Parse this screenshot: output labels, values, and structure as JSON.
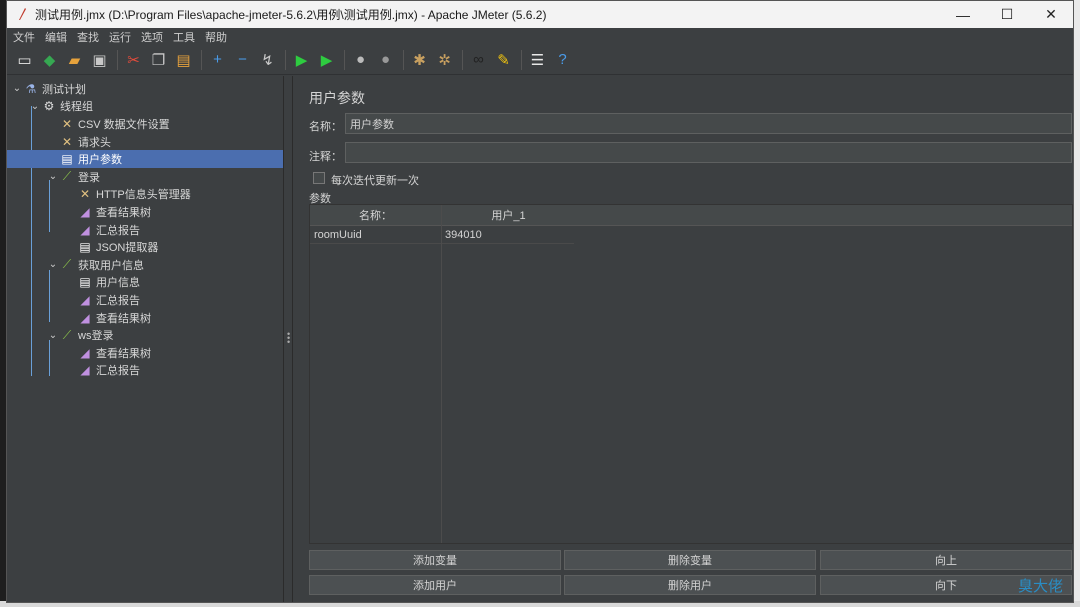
{
  "window": {
    "title": "测试用例.jmx (D:\\Program Files\\apache-jmeter-5.6.2\\用例\\测试用例.jmx) - Apache JMeter (5.6.2)",
    "minimize": "—",
    "maximize": "☐",
    "close": "✕"
  },
  "menu": [
    "文件",
    "编辑",
    "查找",
    "运行",
    "选项",
    "工具",
    "帮助"
  ],
  "toolbar": [
    {
      "icon": "new-icon",
      "glyph": "▭",
      "color": "#e8e8e8"
    },
    {
      "icon": "templates-icon",
      "glyph": "◆",
      "color": "#36a852"
    },
    {
      "icon": "open-icon",
      "glyph": "▰",
      "color": "#e6a23c"
    },
    {
      "icon": "save-icon",
      "glyph": "▣",
      "color": "#c8c8c8"
    },
    {
      "icon": "cut-icon",
      "glyph": "✂",
      "color": "#e74c3c"
    },
    {
      "icon": "copy-icon",
      "glyph": "❐",
      "color": "#c8c8c8"
    },
    {
      "icon": "paste-icon",
      "glyph": "▤",
      "color": "#e6a23c"
    },
    {
      "icon": "expand-icon",
      "glyph": "+",
      "color": "#4a9be8"
    },
    {
      "icon": "collapse-icon",
      "glyph": "−",
      "color": "#4a9be8"
    },
    {
      "icon": "toggle-icon",
      "glyph": "↯",
      "color": "#c8c8c8"
    },
    {
      "icon": "start-icon",
      "glyph": "▶",
      "color": "#2ecc40"
    },
    {
      "icon": "start-no-pause-icon",
      "glyph": "▶",
      "color": "#2ecc40"
    },
    {
      "icon": "stop-icon",
      "glyph": "●",
      "color": "#bbbbbb"
    },
    {
      "icon": "shutdown-icon",
      "glyph": "●",
      "color": "#999999"
    },
    {
      "icon": "clear-icon",
      "glyph": "✱",
      "color": "#c8a060"
    },
    {
      "icon": "clear-all-icon",
      "glyph": "✲",
      "color": "#c8a060"
    },
    {
      "icon": "search-icon",
      "glyph": "∞",
      "color": "#222222"
    },
    {
      "icon": "reset-search-icon",
      "glyph": "✎",
      "color": "#f1c40f"
    },
    {
      "icon": "function-helper-icon",
      "glyph": "☰",
      "color": "#e8e8e8"
    },
    {
      "icon": "help-icon",
      "glyph": "?",
      "color": "#4a9be8"
    }
  ],
  "tree": [
    {
      "level": 0,
      "label": "测试计划",
      "icon": "flask-icon",
      "glyph": "⚗",
      "color": "#9ab4e8",
      "toggle": "⌄",
      "selected": false
    },
    {
      "level": 1,
      "label": "线程组",
      "icon": "gear-icon",
      "glyph": "⚙",
      "color": "#dcdcdc",
      "toggle": "⌄",
      "selected": false
    },
    {
      "level": 2,
      "label": "CSV 数据文件设置",
      "icon": "tools-icon",
      "glyph": "✕",
      "color": "#e0c080",
      "toggle": "",
      "selected": false
    },
    {
      "level": 2,
      "label": "请求头",
      "icon": "tools-icon",
      "glyph": "✕",
      "color": "#e0c080",
      "toggle": "",
      "selected": false
    },
    {
      "level": 2,
      "label": "用户参数",
      "icon": "document-icon",
      "glyph": "▤",
      "color": "#ffffff",
      "toggle": "",
      "selected": true
    },
    {
      "level": 2,
      "label": "登录",
      "icon": "sampler-icon",
      "glyph": "⟋",
      "color": "#8bc34a",
      "toggle": "⌄",
      "selected": false
    },
    {
      "level": 3,
      "label": "HTTP信息头管理器",
      "icon": "tools-icon",
      "glyph": "✕",
      "color": "#e0c080",
      "toggle": "",
      "selected": false
    },
    {
      "level": 3,
      "label": "查看结果树",
      "icon": "chart-icon",
      "glyph": "◢",
      "color": "#c090e0",
      "toggle": "",
      "selected": false
    },
    {
      "level": 3,
      "label": "汇总报告",
      "icon": "chart-icon",
      "glyph": "◢",
      "color": "#c090e0",
      "toggle": "",
      "selected": false
    },
    {
      "level": 3,
      "label": "JSON提取器",
      "icon": "document-icon",
      "glyph": "▤",
      "color": "#ffffff",
      "toggle": "",
      "selected": false
    },
    {
      "level": 2,
      "label": "获取用户信息",
      "icon": "sampler-icon",
      "glyph": "⟋",
      "color": "#8bc34a",
      "toggle": "⌄",
      "selected": false
    },
    {
      "level": 3,
      "label": "用户信息",
      "icon": "document-icon",
      "glyph": "▤",
      "color": "#ffffff",
      "toggle": "",
      "selected": false
    },
    {
      "level": 3,
      "label": "汇总报告",
      "icon": "chart-icon",
      "glyph": "◢",
      "color": "#c090e0",
      "toggle": "",
      "selected": false
    },
    {
      "level": 3,
      "label": "查看结果树",
      "icon": "chart-icon",
      "glyph": "◢",
      "color": "#c090e0",
      "toggle": "",
      "selected": false
    },
    {
      "level": 2,
      "label": "ws登录",
      "icon": "sampler-icon",
      "glyph": "⟋",
      "color": "#8bc34a",
      "toggle": "⌄",
      "selected": false
    },
    {
      "level": 3,
      "label": "查看结果树",
      "icon": "chart-icon",
      "glyph": "◢",
      "color": "#c090e0",
      "toggle": "",
      "selected": false
    },
    {
      "level": 3,
      "label": "汇总报告",
      "icon": "chart-icon",
      "glyph": "◢",
      "color": "#c090e0",
      "toggle": "",
      "selected": false
    }
  ],
  "panel": {
    "title": "用户参数",
    "name_label": "名称：",
    "name_value": "用户参数",
    "comment_label": "注释：",
    "comment_value": "",
    "checkbox_label": "每次迭代更新一次",
    "params_label": "参数",
    "columns": [
      "名称：",
      "用户_1"
    ],
    "rows": [
      [
        "roomUuid",
        "394010"
      ]
    ]
  },
  "buttons": {
    "add_variable": "添加变量",
    "delete_variable": "删除变量",
    "move_up": "向上",
    "add_user": "添加用户",
    "delete_user": "删除用户",
    "move_down": "向下"
  },
  "watermark": "臭大佬"
}
